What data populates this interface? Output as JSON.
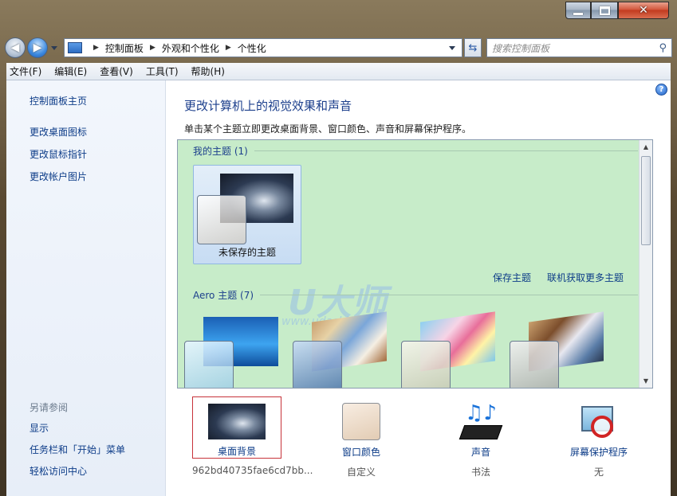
{
  "titlebar": {
    "minimize_label": "",
    "maximize_label": "",
    "close_label": "✕"
  },
  "navigation": {
    "breadcrumbs": [
      "控制面板",
      "外观和个性化",
      "个性化"
    ],
    "search_placeholder": "搜索控制面板"
  },
  "menubar": {
    "items": [
      "文件(F)",
      "编辑(E)",
      "查看(V)",
      "工具(T)",
      "帮助(H)"
    ]
  },
  "sidebar": {
    "home": "控制面板主页",
    "links": [
      "更改桌面图标",
      "更改鼠标指针",
      "更改帐户图片"
    ],
    "see_also_title": "另请参阅",
    "see_also_links": [
      "显示",
      "任务栏和「开始」菜单",
      "轻松访问中心"
    ]
  },
  "main": {
    "title": "更改计算机上的视觉效果和声音",
    "subtitle": "单击某个主题立即更改桌面背景、窗口颜色、声音和屏幕保护程序。",
    "help_label": "?",
    "my_themes_header": "我的主题 (1)",
    "unsaved_theme_label": "未保存的主题",
    "save_theme_link": "保存主题",
    "online_themes_link": "联机获取更多主题",
    "aero_header": "Aero 主题 (7)",
    "watermark": "U大师",
    "watermark_url": "www.udashi.com"
  },
  "bottom": {
    "desktop_background": {
      "label": "桌面背景",
      "value": "962bd40735fae6cd7bb..."
    },
    "window_color": {
      "label": "窗口颜色",
      "value": "自定义"
    },
    "sounds": {
      "label": "声音",
      "value": "书法"
    },
    "screensaver": {
      "label": "屏幕保护程序",
      "value": "无"
    }
  },
  "colors": {
    "link": "#0d3c88",
    "theme_area": "#c7ecc9",
    "selected_border": "#c7333a",
    "window_color_swatch": "#e9d6c2"
  }
}
